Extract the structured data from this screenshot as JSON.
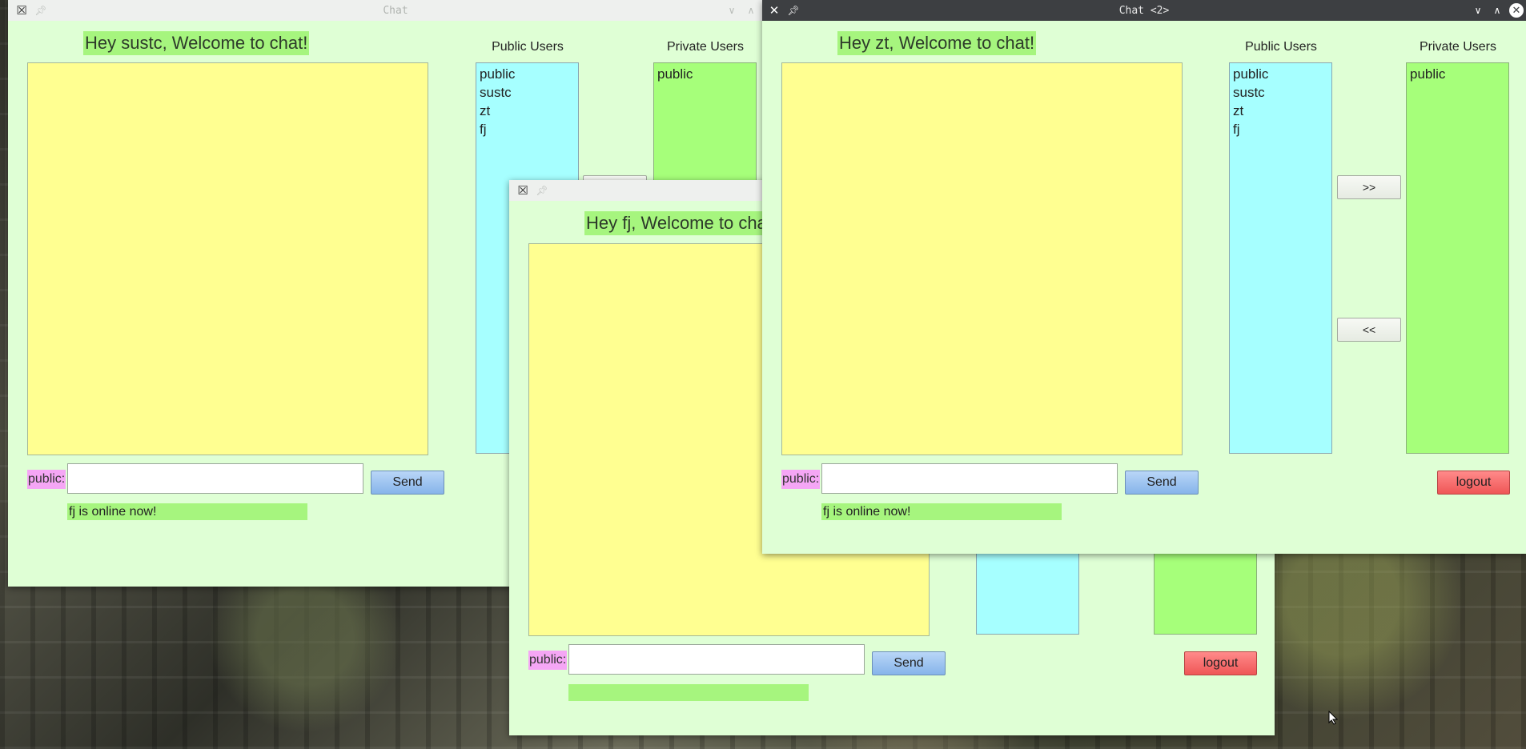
{
  "win1": {
    "title": "Chat",
    "welcome": "Hey sustc, Welcome to  chat!",
    "public_header": "Public Users",
    "private_header": "Private Users",
    "public_users": [
      "public",
      "sustc",
      "zt",
      "fj"
    ],
    "private_users": [
      "public"
    ],
    "prefix": "public:",
    "input_value": "",
    "send_label": "Send",
    "status": "fj is online now!"
  },
  "win3": {
    "welcome": "Hey fj, Welcome to  chat!",
    "prefix": "public:",
    "input_value": "",
    "send_label": "Send",
    "logout_label": "logout",
    "status": ""
  },
  "win2": {
    "title": "Chat <2>",
    "welcome": "Hey zt, Welcome to  chat!",
    "public_header": "Public Users",
    "private_header": "Private Users",
    "public_users": [
      "public",
      "sustc",
      "zt",
      "fj"
    ],
    "private_users": [
      "public"
    ],
    "add_label": ">>",
    "remove_label": "<<",
    "prefix": "public:",
    "input_value": "",
    "send_label": "Send",
    "logout_label": "logout",
    "status": "fj is online now!"
  },
  "colors": {
    "window_bg": "#dfffd5",
    "chat_area": "#ffff91",
    "public_list": "#a6ffff",
    "private_list": "#a6ff7a",
    "welcome_bg": "#a6f57e",
    "prefix_bg": "#f5a6f5",
    "logout": "#ef5656",
    "send": "#86b4ea"
  }
}
